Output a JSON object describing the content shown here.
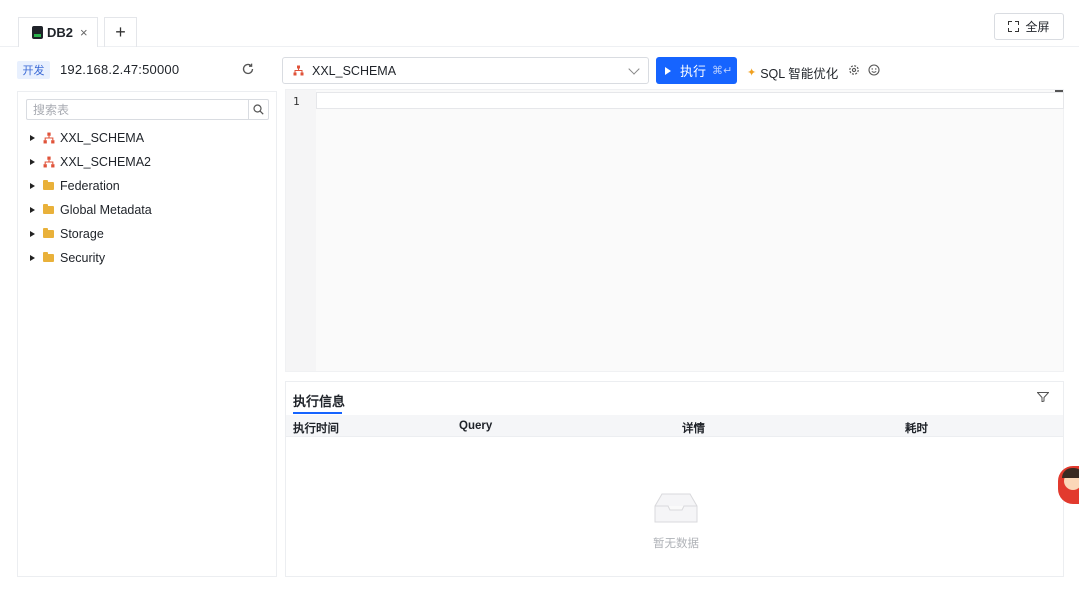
{
  "tabs": [
    {
      "label": "DB2",
      "close": "×"
    }
  ],
  "tab_add": "+",
  "fullscreen_label": "全屏",
  "connection": {
    "env_badge": "开发",
    "host": "192.168.2.47:50000"
  },
  "schema_select": {
    "value": "XXL_SCHEMA"
  },
  "run_button": {
    "label": "执行",
    "shortcut": "⌘↵"
  },
  "sql_optimize": {
    "label": "SQL 智能优化"
  },
  "search": {
    "placeholder": "搜索表"
  },
  "tree": [
    {
      "label": "XXL_SCHEMA",
      "icon": "schema-icon"
    },
    {
      "label": "XXL_SCHEMA2",
      "icon": "schema-icon"
    },
    {
      "label": "Federation",
      "icon": "folder-icon"
    },
    {
      "label": "Global Metadata",
      "icon": "folder-icon"
    },
    {
      "label": "Storage",
      "icon": "folder-icon"
    },
    {
      "label": "Security",
      "icon": "folder-icon"
    }
  ],
  "editor": {
    "line_number": "1"
  },
  "results": {
    "tab_label": "执行信息",
    "columns": [
      "执行时间",
      "Query",
      "详情",
      "耗时"
    ],
    "empty_text": "暂无数据"
  },
  "colors": {
    "accent": "#1664ff",
    "schema_icon": "#e0533a",
    "folder": "#e9b13a"
  }
}
